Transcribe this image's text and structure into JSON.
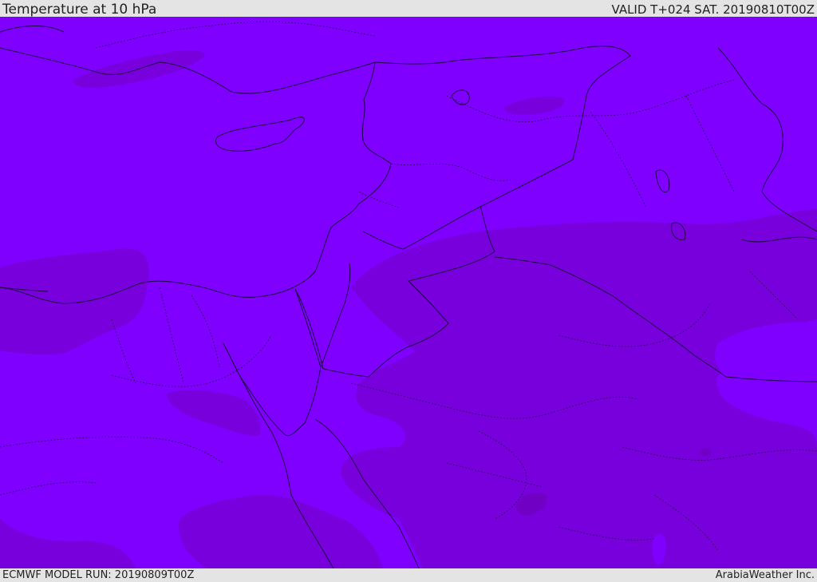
{
  "header": {
    "title": "Temperature at 10 hPa",
    "valid": "VALID T+024 SAT. 20190810T00Z"
  },
  "footer": {
    "model_run": "ECMWF MODEL RUN: 20190809T00Z",
    "credit": "ArabiaWeather Inc."
  },
  "colors": {
    "background_field": "#7f00ff",
    "colder_field": "#7a00dd",
    "coldest_spots": "#7500c8"
  }
}
